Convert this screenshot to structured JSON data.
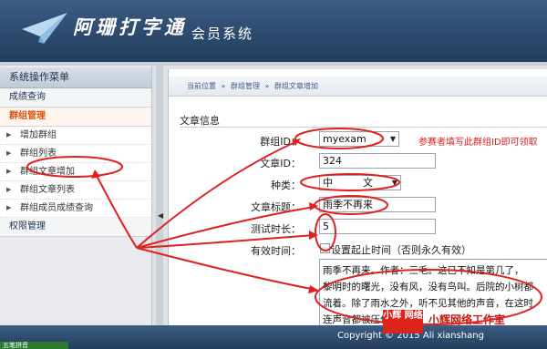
{
  "header": {
    "logo_icon": "paper-plane-icon",
    "app_title": "阿珊打字通",
    "app_subtitle": "会员系统"
  },
  "sidebar": {
    "title": "系统操作菜单",
    "groups": [
      {
        "label": "成绩查询"
      },
      {
        "label": "群组管理"
      },
      {
        "label": "权限管理"
      }
    ],
    "items": [
      {
        "label": "增加群组"
      },
      {
        "label": "群组列表"
      },
      {
        "label": "群组文章增加"
      },
      {
        "label": "群组文章列表"
      },
      {
        "label": "群组成员成绩查询"
      }
    ],
    "collapse_icon": "collapse-left-icon"
  },
  "breadcrumb": {
    "items": [
      "当前位置",
      "群组管理",
      "群组文章增加"
    ],
    "separator": "»"
  },
  "form": {
    "section_title": "文章信息",
    "group_id_label": "群组ID：",
    "group_id_value": "myexam",
    "group_id_hint": "参赛者填写此群组ID即可领取",
    "article_id_label": "文章ID：",
    "article_id_value": "324",
    "type_label": "种类：",
    "type_value": "中　　　文",
    "article_title_label": "文章标题：",
    "article_title_value": "雨季不再来",
    "test_duration_label": "测试时长：",
    "test_duration_value": "5",
    "valid_time_label": "有效时间：",
    "valid_time_checkbox_label": "设置起止时间（否则永久有效）",
    "content_lines": [
      "雨季不再来。作者：三毛。这已不知是第几了，",
      "黎明时的曙光，没有风，没有鸟叫。后院的小树都",
      "流着。除了雨水之外，听不见其他的声音，在这时",
      "连声音都被压住。"
    ]
  },
  "footer": {
    "copyright": "Copyright © 2015 Ali xianshang"
  },
  "ime": {
    "label": "五笔拼音"
  },
  "watermark": {
    "logo_text": "小辉 网络",
    "text": "小辉网络工作室"
  },
  "colors": {
    "header_bg": "#2d4a6e",
    "active_group": "#d9530e",
    "hint_red": "#dd2222",
    "annotation_red": "#e02020"
  }
}
